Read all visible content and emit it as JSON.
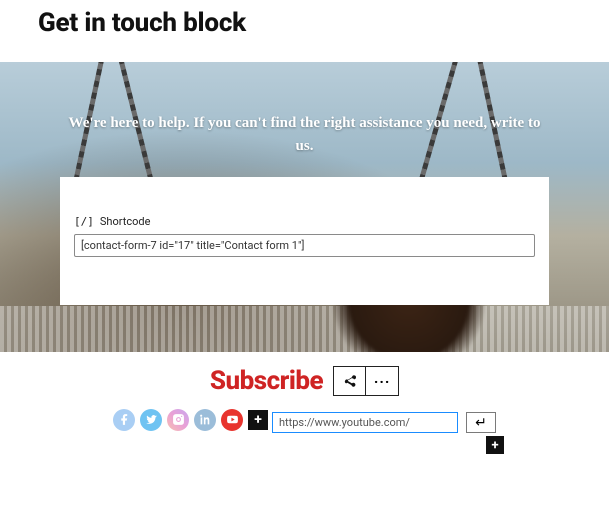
{
  "page": {
    "title": "Get in touch block"
  },
  "hero": {
    "text": "We're here to help. If you can't find the right assistance you need, write to us."
  },
  "shortcode": {
    "icon_text": "[/]",
    "label": "Shortcode",
    "value": "[contact-form-7 id=\"17\" title=\"Contact form 1\"]"
  },
  "subscribe": {
    "title": "Subscribe",
    "toolbar": {
      "share_glyph": "⪪",
      "more_glyph": "···"
    }
  },
  "socials": {
    "items": [
      {
        "name": "facebook"
      },
      {
        "name": "twitter"
      },
      {
        "name": "instagram"
      },
      {
        "name": "linkedin"
      },
      {
        "name": "youtube"
      }
    ],
    "add_glyph": "+",
    "url_value": "https://www.youtube.com/",
    "submit_glyph": "↵",
    "add_below_glyph": "+"
  },
  "colors": {
    "accent_red": "#cf2424",
    "selected_outline": "#1a8cff"
  }
}
